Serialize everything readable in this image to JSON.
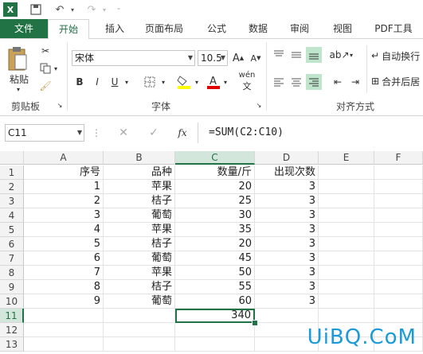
{
  "quick_access": {
    "excel_logo": "X"
  },
  "tabs": {
    "file": "文件",
    "items": [
      "开始",
      "插入",
      "页面布局",
      "公式",
      "数据",
      "审阅",
      "视图",
      "PDF工具"
    ]
  },
  "ribbon": {
    "paste_label": "粘贴",
    "clipboard_group": "剪贴板",
    "font_name": "宋体",
    "font_size": "10.5",
    "font_group": "字体",
    "bold": "B",
    "italic": "I",
    "underline": "U",
    "phonetic": "wén",
    "wrap_text": "自动换行",
    "merge_center": "合并后居",
    "align_group": "对齐方式"
  },
  "formula_bar": {
    "name_box": "C11",
    "fx": "fx",
    "formula": "=SUM(C2:C10)"
  },
  "sheet": {
    "columns": [
      "A",
      "B",
      "C",
      "D",
      "E",
      "F"
    ],
    "rows": [
      "1",
      "2",
      "3",
      "4",
      "5",
      "6",
      "7",
      "8",
      "9",
      "10",
      "11",
      "12",
      "13"
    ],
    "header": [
      "序号",
      "品种",
      "数量/斤",
      "出现次数"
    ],
    "data": [
      [
        "1",
        "苹果",
        "20",
        "3"
      ],
      [
        "2",
        "桔子",
        "25",
        "3"
      ],
      [
        "3",
        "葡萄",
        "30",
        "3"
      ],
      [
        "4",
        "苹果",
        "35",
        "3"
      ],
      [
        "5",
        "桔子",
        "20",
        "3"
      ],
      [
        "6",
        "葡萄",
        "45",
        "3"
      ],
      [
        "7",
        "苹果",
        "50",
        "3"
      ],
      [
        "8",
        "桔子",
        "55",
        "3"
      ],
      [
        "9",
        "葡萄",
        "60",
        "3"
      ]
    ],
    "total": "340",
    "selected_cell": "C11"
  },
  "colors": {
    "accent": "#217346",
    "watermark": "#1a9bd7"
  },
  "watermark": "UiBQ.CoM"
}
